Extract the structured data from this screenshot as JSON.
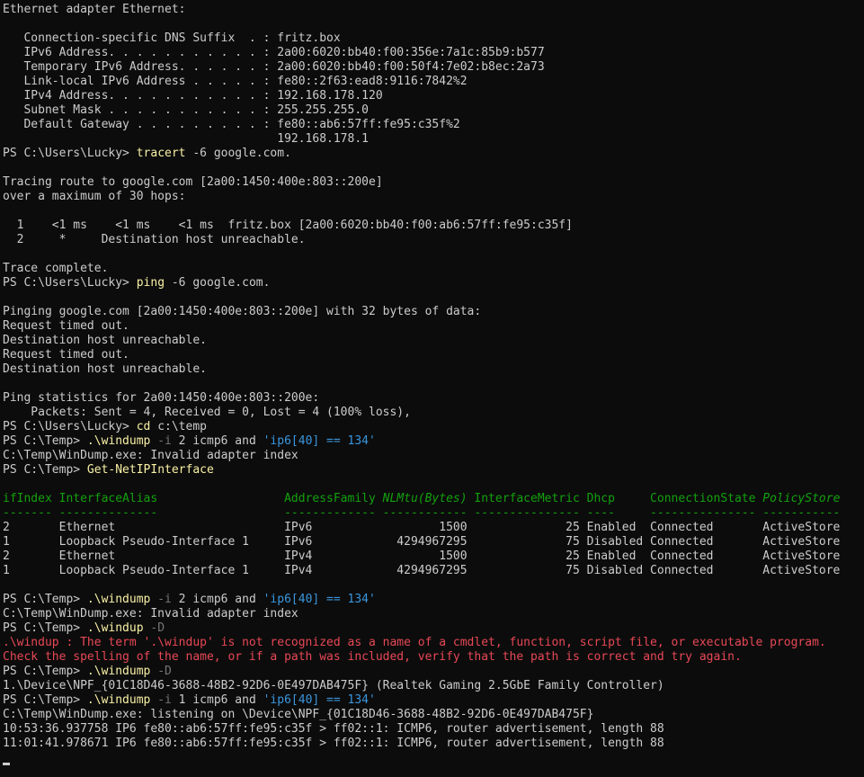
{
  "terminal": {
    "lines": [
      {
        "segments": [
          {
            "t": "Ethernet adapter Ethernet:"
          }
        ]
      },
      {
        "segments": [
          {
            "t": ""
          }
        ]
      },
      {
        "segments": [
          {
            "t": "   Connection-specific DNS Suffix  . : fritz.box"
          }
        ]
      },
      {
        "segments": [
          {
            "t": "   IPv6 Address. . . . . . . . . . . : 2a00:6020:bb40:f00:356e:7a1c:85b9:b577"
          }
        ]
      },
      {
        "segments": [
          {
            "t": "   Temporary IPv6 Address. . . . . . : 2a00:6020:bb40:f00:50f4:7e02:b8ec:2a73"
          }
        ]
      },
      {
        "segments": [
          {
            "t": "   Link-local IPv6 Address . . . . . : fe80::2f63:ead8:9116:7842%2"
          }
        ]
      },
      {
        "segments": [
          {
            "t": "   IPv4 Address. . . . . . . . . . . : 192.168.178.120"
          }
        ]
      },
      {
        "segments": [
          {
            "t": "   Subnet Mask . . . . . . . . . . . : 255.255.255.0"
          }
        ]
      },
      {
        "segments": [
          {
            "t": "   Default Gateway . . . . . . . . . : fe80::ab6:57ff:fe95:c35f%2"
          }
        ]
      },
      {
        "segments": [
          {
            "t": "                                       192.168.178.1"
          }
        ]
      },
      {
        "segments": [
          {
            "t": "PS C:\\Users\\Lucky> "
          },
          {
            "t": "tracert",
            "c": "cmd"
          },
          {
            "t": " -6 google.com."
          }
        ]
      },
      {
        "segments": [
          {
            "t": ""
          }
        ]
      },
      {
        "segments": [
          {
            "t": "Tracing route to google.com [2a00:1450:400e:803::200e]"
          }
        ]
      },
      {
        "segments": [
          {
            "t": "over a maximum of 30 hops:"
          }
        ]
      },
      {
        "segments": [
          {
            "t": ""
          }
        ]
      },
      {
        "segments": [
          {
            "t": "  1    <1 ms    <1 ms    <1 ms  fritz.box [2a00:6020:bb40:f00:ab6:57ff:fe95:c35f]"
          }
        ]
      },
      {
        "segments": [
          {
            "t": "  2     *     Destination host unreachable."
          }
        ]
      },
      {
        "segments": [
          {
            "t": ""
          }
        ]
      },
      {
        "segments": [
          {
            "t": "Trace complete."
          }
        ]
      },
      {
        "segments": [
          {
            "t": "PS C:\\Users\\Lucky> "
          },
          {
            "t": "ping",
            "c": "cmd"
          },
          {
            "t": " -6 google.com."
          }
        ]
      },
      {
        "segments": [
          {
            "t": ""
          }
        ]
      },
      {
        "segments": [
          {
            "t": "Pinging google.com [2a00:1450:400e:803::200e] with 32 bytes of data:"
          }
        ]
      },
      {
        "segments": [
          {
            "t": "Request timed out."
          }
        ]
      },
      {
        "segments": [
          {
            "t": "Destination host unreachable."
          }
        ]
      },
      {
        "segments": [
          {
            "t": "Request timed out."
          }
        ]
      },
      {
        "segments": [
          {
            "t": "Destination host unreachable."
          }
        ]
      },
      {
        "segments": [
          {
            "t": ""
          }
        ]
      },
      {
        "segments": [
          {
            "t": "Ping statistics for 2a00:1450:400e:803::200e:"
          }
        ]
      },
      {
        "segments": [
          {
            "t": "    Packets: Sent = 4, Received = 0, Lost = 4 (100% loss),"
          }
        ]
      },
      {
        "segments": [
          {
            "t": "PS C:\\Users\\Lucky> "
          },
          {
            "t": "cd",
            "c": "cmd"
          },
          {
            "t": " c:\\temp"
          }
        ]
      },
      {
        "segments": [
          {
            "t": "PS C:\\Temp> "
          },
          {
            "t": ".\\windump",
            "c": "cmd"
          },
          {
            "t": " -i",
            "c": "flag"
          },
          {
            "t": " 2 icmp6 and "
          },
          {
            "t": "'ip6[40] == 134'",
            "c": "str"
          }
        ]
      },
      {
        "segments": [
          {
            "t": "C:\\Temp\\WinDump.exe: Invalid adapter index"
          }
        ]
      },
      {
        "segments": [
          {
            "t": "PS C:\\Temp> "
          },
          {
            "t": "Get-NetIPInterface",
            "c": "cmd"
          }
        ]
      },
      {
        "segments": [
          {
            "t": ""
          }
        ]
      },
      {
        "segments": [
          {
            "t": "ifIndex InterfaceAlias                  AddressFamily ",
            "c": "hdr"
          },
          {
            "t": "NLMtu(Bytes)",
            "c": "hdri"
          },
          {
            "t": " InterfaceMetric Dhcp     ConnectionState ",
            "c": "hdr"
          },
          {
            "t": "PolicyStore",
            "c": "hdri"
          }
        ]
      },
      {
        "segments": [
          {
            "t": "------- --------------                  ------------- ------------ --------------- ----     --------------- -----------",
            "c": "hdr"
          }
        ]
      },
      {
        "segments": [
          {
            "t": "2       Ethernet                        IPv6                  1500              25 Enabled  Connected       ActiveStore"
          }
        ]
      },
      {
        "segments": [
          {
            "t": "1       Loopback Pseudo-Interface 1     IPv6            4294967295              75 Disabled Connected       ActiveStore"
          }
        ]
      },
      {
        "segments": [
          {
            "t": "2       Ethernet                        IPv4                  1500              25 Enabled  Connected       ActiveStore"
          }
        ]
      },
      {
        "segments": [
          {
            "t": "1       Loopback Pseudo-Interface 1     IPv4            4294967295              75 Disabled Connected       ActiveStore"
          }
        ]
      },
      {
        "segments": [
          {
            "t": ""
          }
        ]
      },
      {
        "segments": [
          {
            "t": "PS C:\\Temp> "
          },
          {
            "t": ".\\windump",
            "c": "cmd"
          },
          {
            "t": " -i",
            "c": "flag"
          },
          {
            "t": " 2 icmp6 and "
          },
          {
            "t": "'ip6[40] == 134'",
            "c": "str"
          }
        ]
      },
      {
        "segments": [
          {
            "t": "C:\\Temp\\WinDump.exe: Invalid adapter index"
          }
        ]
      },
      {
        "segments": [
          {
            "t": "PS C:\\Temp> "
          },
          {
            "t": ".\\windup",
            "c": "cmd"
          },
          {
            "t": " -D",
            "c": "flag"
          }
        ]
      },
      {
        "segments": [
          {
            "t": ".\\windup : The term '.\\windup' is not recognized as a name of a cmdlet, function, script file, or executable program.",
            "c": "err"
          }
        ]
      },
      {
        "segments": [
          {
            "t": "Check the spelling of the name, or if a path was included, verify that the path is correct and try again.",
            "c": "err"
          }
        ]
      },
      {
        "segments": [
          {
            "t": "PS C:\\Temp> "
          },
          {
            "t": ".\\windump",
            "c": "cmd"
          },
          {
            "t": " -D",
            "c": "flag"
          }
        ]
      },
      {
        "segments": [
          {
            "t": "1.\\Device\\NPF_{01C18D46-3688-48B2-92D6-0E497DAB475F} (Realtek Gaming 2.5GbE Family Controller)"
          }
        ]
      },
      {
        "segments": [
          {
            "t": "PS C:\\Temp> "
          },
          {
            "t": ".\\windump",
            "c": "cmd"
          },
          {
            "t": " -i",
            "c": "flag"
          },
          {
            "t": " 1 icmp6 and "
          },
          {
            "t": "'ip6[40] == 134'",
            "c": "str"
          }
        ]
      },
      {
        "segments": [
          {
            "t": "C:\\Temp\\WinDump.exe: listening on \\Device\\NPF_{01C18D46-3688-48B2-92D6-0E497DAB475F}"
          }
        ]
      },
      {
        "segments": [
          {
            "t": "10:53:36.937758 IP6 fe80::ab6:57ff:fe95:c35f > ff02::1: ICMP6, router advertisement, length 88"
          }
        ]
      },
      {
        "segments": [
          {
            "t": "11:01:41.978671 IP6 fe80::ab6:57ff:fe95:c35f > ff02::1: ICMP6, router advertisement, length 88"
          }
        ]
      },
      {
        "segments": [
          {
            "t": ""
          }
        ]
      }
    ]
  },
  "colors": {
    "background": "#0c0c0c",
    "text": "#cccccc",
    "command": "#f9f1a5",
    "parameter": "#767676",
    "string": "#3a96dd",
    "error": "#e74856",
    "table_header": "#13a10e"
  }
}
